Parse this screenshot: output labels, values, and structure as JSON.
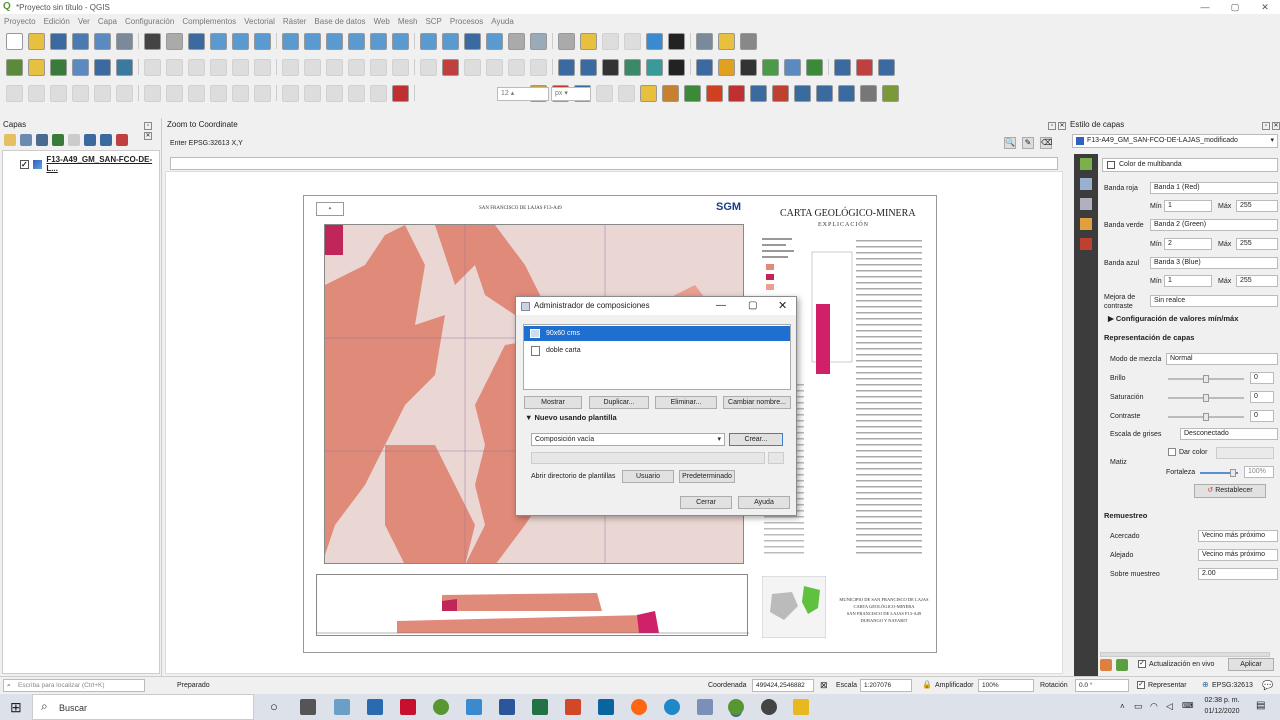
{
  "window": {
    "title": "*Proyecto sin título - QGIS"
  },
  "menu": [
    "Proyecto",
    "Edición",
    "Ver",
    "Capa",
    "Configuración",
    "Complementos",
    "Vectorial",
    "Ráster",
    "Base de datos",
    "Web",
    "Mesh",
    "SCP",
    "Procesos",
    "Ayuda"
  ],
  "toolbar": {
    "size_value": "12",
    "size_unit": "px"
  },
  "layers_panel": {
    "title": "Capas",
    "layer_name": "F13-A49_GM_SAN-FCO-DE-L..."
  },
  "zoom_panel": {
    "title": "Zoom to Coordinate",
    "label": "Enter EPSG:32613 X,Y"
  },
  "map": {
    "sheet_header": "SAN FRANCISCO DE LAJAS F13-A49",
    "logo": "SGM",
    "right_title": "CARTA GEOLÓGICO-MINERA",
    "right_subtitle": "EXPLICACIÓN",
    "footer_text": [
      "MUNICIPIO DE SAN FRANCISCO DE LAJAS",
      "CARTA GEOLÓGICO-MINERA",
      "SAN FRANCISCO DE LAJAS F13-A49",
      "DURANGO Y NAYARIT"
    ]
  },
  "style_panel": {
    "title": "Estilo de capas",
    "layer": "F13-A49_GM_SAN-FCO-DE-LAJAS_modificado",
    "renderer": "Color de multibanda",
    "red_label": "Banda roja",
    "red_value": "Banda 1 (Red)",
    "green_label": "Banda verde",
    "green_value": "Banda 2 (Green)",
    "blue_label": "Banda azul",
    "blue_value": "Banda 3 (Blue)",
    "min_label": "Mín",
    "max_label": "Máx",
    "red_min": "1",
    "red_max": "255",
    "green_min": "2",
    "green_max": "255",
    "blue_min": "1",
    "blue_max": "255",
    "contrast_label": "Mejora de contraste",
    "contrast_value": "Sin realce",
    "minmax_section": "Configuración de valores mín/máx",
    "render_section": "Representación de capas",
    "blend_label": "Modo de mezcla",
    "blend_value": "Normal",
    "brightness_label": "Brillo",
    "brightness_value": "0",
    "saturation_label": "Saturación",
    "saturation_value": "0",
    "contrast2_label": "Contraste",
    "contrast2_value": "0",
    "gray_label": "Escala de grises",
    "gray_value": "Desconectado",
    "hue_label": "Matiz",
    "colorize_label": "Dar color",
    "strength_label": "Fortaleza",
    "strength_value": "100%",
    "reset_button": "Restablecer",
    "resample_section": "Remuestreo",
    "zoomin_label": "Acercado",
    "zoomin_value": "Vecino más próximo",
    "zoomout_label": "Alejado",
    "zoomout_value": "Vecino más próximo",
    "oversample_label": "Sobre muestreo",
    "oversample_value": "2.00",
    "live_update_label": "Actualización en vivo",
    "apply_button": "Aplicar"
  },
  "dialog": {
    "title": "Administrador de composiciones",
    "layouts": [
      "90x60 cms",
      "doble carta"
    ],
    "btn_show": "Mostrar",
    "btn_duplicate": "Duplicar...",
    "btn_delete": "Eliminar...",
    "btn_rename": "Cambiar nombre...",
    "new_section": "Nuevo usando plantilla",
    "template_value": "Composición vacía",
    "btn_create": "Crear...",
    "open_dir_label": "Abrir directorio de plantillas",
    "btn_user": "Usuario",
    "btn_default": "Predeterminado",
    "btn_close": "Cerrar",
    "btn_help": "Ayuda"
  },
  "statusbar": {
    "search_placeholder": "Escriba para localizar (Ctrl+K)",
    "status": "Preparado",
    "coord_label": "Coordenada",
    "coord_value": "499424,2546882",
    "scale_label": "Escala",
    "scale_value": "1:207076",
    "magnifier_label": "Amplificador",
    "magnifier_value": "100%",
    "rotation_label": "Rotación",
    "rotation_value": "0.0 °",
    "render_label": "Representar",
    "crs": "EPSG:32613"
  },
  "taskbar": {
    "search": "Buscar",
    "time": "02:38 p. m.",
    "date": "01/12/2020"
  }
}
